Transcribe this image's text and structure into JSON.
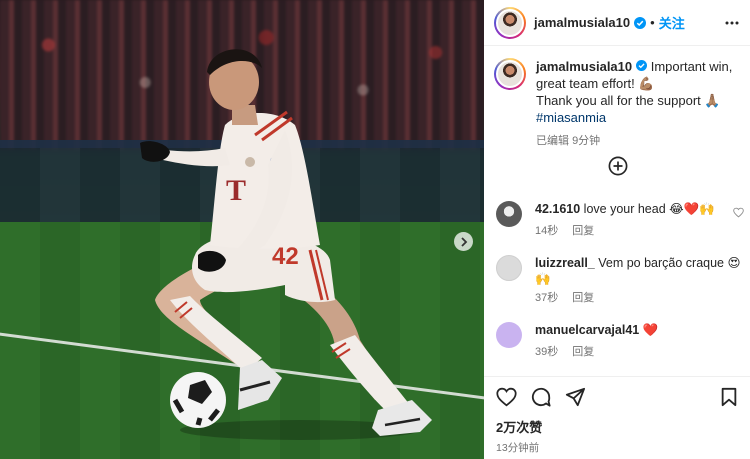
{
  "header": {
    "username": "jamalmusiala10",
    "separator": "•",
    "follow_label": "关注",
    "more_icon": "more-horizontal-icon"
  },
  "caption": {
    "username": "jamalmusiala10",
    "text_line1": " Important win,",
    "text_line2": "great team effort! 💪🏽",
    "text_line3": "Thank you all for the support 🙏🏽",
    "hashtag": "#miasanmia",
    "edited": "已编辑",
    "time": "9分钟"
  },
  "comments": [
    {
      "user": "42.1610",
      "text": " love your head 😂❤️🙌",
      "time": "14秒",
      "reply": "回复",
      "avatar_color": "#7a7a7a"
    },
    {
      "user": "luizzreall_",
      "text": " Vem po barção craque 😍",
      "text2": "🙌",
      "time": "37秒",
      "reply": "回复",
      "avatar_color": "#dbdbdb"
    },
    {
      "user": "manuelcarvajal41",
      "text": " ❤️",
      "time": "39秒",
      "reply": "回复",
      "avatar_color": "#c9b3f0"
    }
  ],
  "actions": {
    "like_icon": "heart-icon",
    "comment_icon": "comment-icon",
    "share_icon": "send-icon",
    "save_icon": "bookmark-icon",
    "likes": "2万次赞",
    "posted": "13分钟前"
  },
  "photo": {
    "jersey_number": "42"
  },
  "colors": {
    "accent": "#0095f6",
    "hashtag": "#00376b",
    "muted": "#737373"
  }
}
